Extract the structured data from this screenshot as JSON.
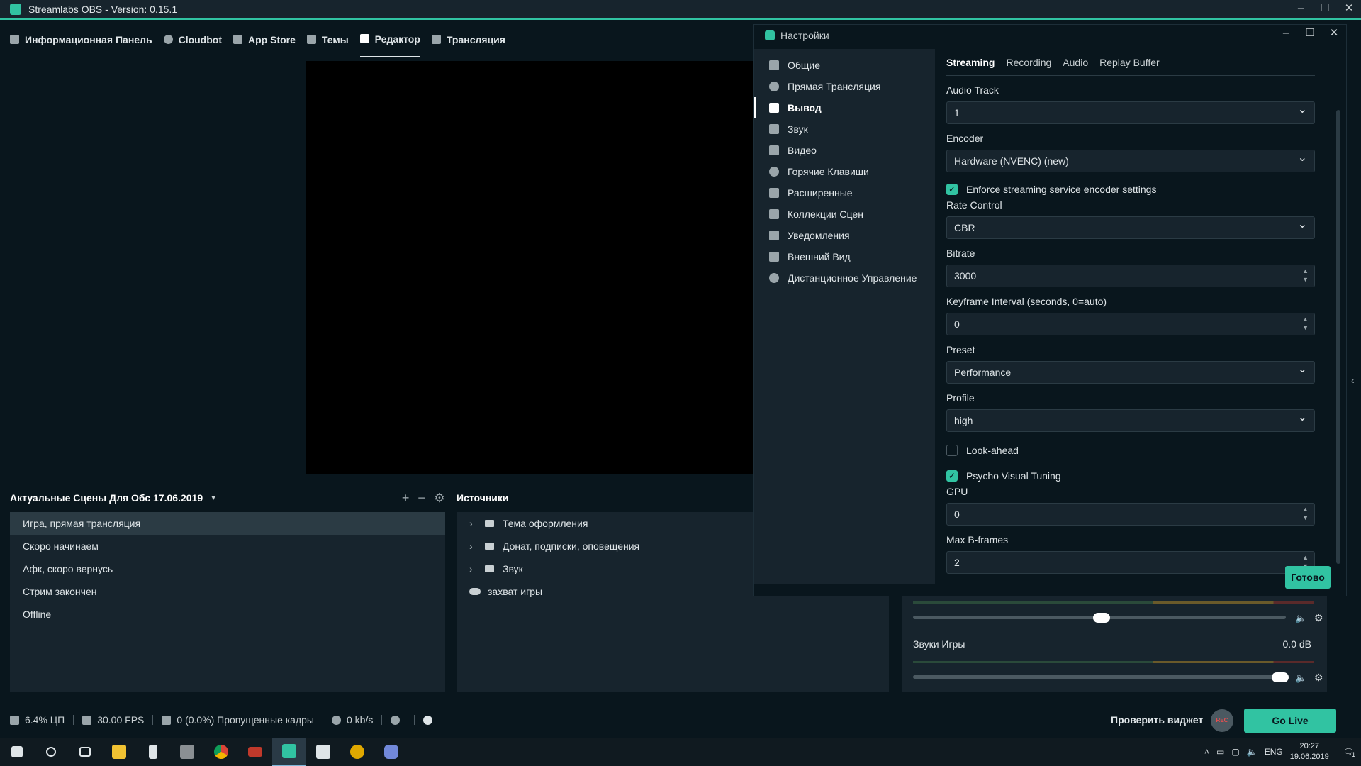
{
  "window": {
    "title": "Streamlabs OBS - Version: 0.15.1"
  },
  "nav": {
    "items": [
      {
        "label": "Информационная Панель"
      },
      {
        "label": "Cloudbot"
      },
      {
        "label": "App Store"
      },
      {
        "label": "Темы"
      },
      {
        "label": "Редактор"
      },
      {
        "label": "Трансляция"
      }
    ]
  },
  "scenes": {
    "title": "Актуальные Сцены Для Обс 17.06.2019",
    "items": [
      "Игра, прямая трансляция",
      "Скоро начинаем",
      "Афк, скоро вернусь",
      "Стрим закончен",
      "Offline"
    ]
  },
  "sources": {
    "title": "Источники",
    "items": [
      "Тема оформления",
      "Донат, подписки, оповещения",
      "Звук",
      "захват игры"
    ]
  },
  "mixer": {
    "item_label": "Звуки Игры",
    "item_value": "0.0 dB"
  },
  "settings": {
    "title": "Настройки",
    "sidebar": [
      "Общие",
      "Прямая Трансляция",
      "Вывод",
      "Звук",
      "Видео",
      "Горячие Клавиши",
      "Расширенные",
      "Коллекции Сцен",
      "Уведомления",
      "Внешний Вид",
      "Дистанционное Управление"
    ],
    "tabs": [
      "Streaming",
      "Recording",
      "Audio",
      "Replay Buffer"
    ],
    "audio_track_label": "Audio Track",
    "audio_track_value": "1",
    "encoder_label": "Encoder",
    "encoder_value": "Hardware (NVENC) (new)",
    "enforce_label": "Enforce streaming service encoder settings",
    "rate_control_label": "Rate Control",
    "rate_control_value": "CBR",
    "bitrate_label": "Bitrate",
    "bitrate_value": "3000",
    "keyframe_label": "Keyframe Interval (seconds, 0=auto)",
    "keyframe_value": "0",
    "preset_label": "Preset",
    "preset_value": "Performance",
    "profile_label": "Profile",
    "profile_value": "high",
    "lookahead_label": "Look-ahead",
    "psycho_label": "Psycho Visual Tuning",
    "gpu_label": "GPU",
    "gpu_value": "0",
    "bframes_label": "Max B-frames",
    "bframes_value": "2",
    "done_label": "Готово"
  },
  "footer": {
    "cpu": "6.4% ЦП",
    "fps": "30.00 FPS",
    "dropped": "0 (0.0%) Пропущенные кадры",
    "bandwidth": "0 kb/s",
    "check_widget": "Проверить виджет",
    "rec": "REC",
    "go_live": "Go Live"
  },
  "taskbar": {
    "lang": "ENG",
    "time": "20:27",
    "date": "19.06.2019",
    "notif_count": "1"
  },
  "colors": {
    "accent": "#31c3a2",
    "bg": "#09161d",
    "panel": "#17242d"
  }
}
